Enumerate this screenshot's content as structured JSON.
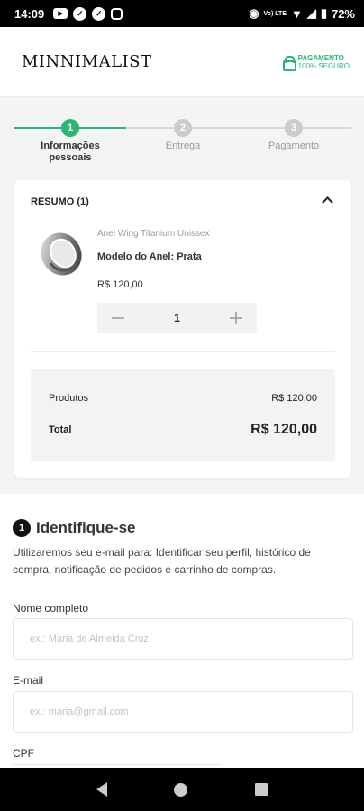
{
  "status_bar": {
    "time": "14:09",
    "battery": "72%",
    "network": "Vo) LTE"
  },
  "header": {
    "logo": "MINNIMALIST",
    "secure_title": "PAGAMENTO",
    "secure_sub": "100% SEGURO"
  },
  "colors": {
    "accent": "#2bb673",
    "inactive": "#cccccc"
  },
  "steps": [
    {
      "number": "1",
      "label": "Informações pessoais",
      "active": true
    },
    {
      "number": "2",
      "label": "Entrega",
      "active": false
    },
    {
      "number": "3",
      "label": "Pagamento",
      "active": false
    }
  ],
  "summary": {
    "title": "RESUMO (1)",
    "product": {
      "name": "Anel Wing Titanium Unissex",
      "variant": "Modelo do Anel: Prata",
      "price": "R$ 120,00",
      "quantity": "1"
    },
    "totals": {
      "products_label": "Produtos",
      "products_value": "R$ 120,00",
      "total_label": "Total",
      "total_value": "R$ 120,00"
    }
  },
  "identify": {
    "number": "1",
    "title": "Identifique-se",
    "description": "Utilizaremos seu e-mail para: Identificar seu perfil, histórico de compra, notificação de pedidos e carrinho de compras.",
    "fields": {
      "name_label": "Nome completo",
      "name_placeholder": "ex.: Maria de Almeida Cruz",
      "email_label": "E-mail",
      "email_placeholder": "ex.: maria@gmail.com",
      "cpf_label": "CPF"
    }
  }
}
